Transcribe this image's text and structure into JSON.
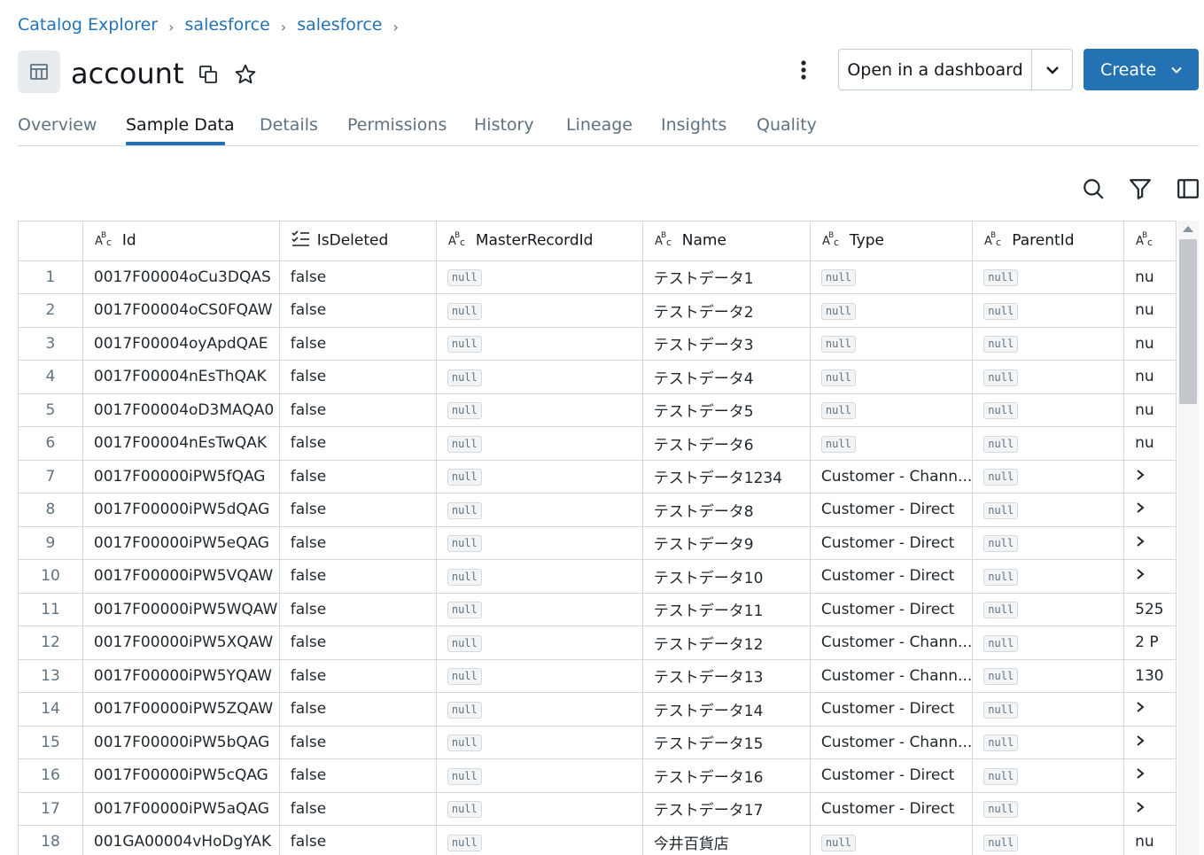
{
  "breadcrumb": [
    {
      "label": "Catalog Explorer"
    },
    {
      "label": "salesforce"
    },
    {
      "label": "salesforce"
    }
  ],
  "title": "account",
  "header_actions": {
    "open_dashboard_label": "Open in a dashboard",
    "create_label": "Create"
  },
  "tabs": [
    {
      "label": "Overview",
      "active": false
    },
    {
      "label": "Sample Data",
      "active": true
    },
    {
      "label": "Details",
      "active": false
    },
    {
      "label": "Permissions",
      "active": false
    },
    {
      "label": "History",
      "active": false
    },
    {
      "label": "Lineage",
      "active": false
    },
    {
      "label": "Insights",
      "active": false
    },
    {
      "label": "Quality",
      "active": false
    }
  ],
  "toolbar_icons": [
    "search-icon",
    "filter-icon",
    "sidebar-panel-icon"
  ],
  "accent_color": "#2272b4",
  "table": {
    "columns": [
      {
        "label": "",
        "icon": ""
      },
      {
        "label": "Id",
        "icon": "string-type-icon"
      },
      {
        "label": "IsDeleted",
        "icon": "boolean-type-icon"
      },
      {
        "label": "MasterRecordId",
        "icon": "string-type-icon"
      },
      {
        "label": "Name",
        "icon": "string-type-icon"
      },
      {
        "label": "Type",
        "icon": "string-type-icon"
      },
      {
        "label": "ParentId",
        "icon": "string-type-icon"
      },
      {
        "label": "",
        "icon": "string-type-icon"
      }
    ],
    "null_label": "null",
    "rows": [
      [
        "1",
        "0017F00004oCu3DQAS",
        "false",
        null,
        "テストデータ1",
        null,
        null,
        "nu"
      ],
      [
        "2",
        "0017F00004oCS0FQAW",
        "false",
        null,
        "テストデータ2",
        null,
        null,
        "nu"
      ],
      [
        "3",
        "0017F00004oyApdQAE",
        "false",
        null,
        "テストデータ3",
        null,
        null,
        "nu"
      ],
      [
        "4",
        "0017F00004nEsThQAK",
        "false",
        null,
        "テストデータ4",
        null,
        null,
        "nu"
      ],
      [
        "5",
        "0017F00004oD3MAQA0",
        "false",
        null,
        "テストデータ5",
        null,
        null,
        "nu"
      ],
      [
        "6",
        "0017F00004nEsTwQAK",
        "false",
        null,
        "テストデータ6",
        null,
        null,
        "nu"
      ],
      [
        "7",
        "0017F00000iPW5fQAG",
        "false",
        null,
        "テストデータ1234",
        "Customer - Chann...",
        null,
        ">"
      ],
      [
        "8",
        "0017F00000iPW5dQAG",
        "false",
        null,
        "テストデータ8",
        "Customer - Direct",
        null,
        ">"
      ],
      [
        "9",
        "0017F00000iPW5eQAG",
        "false",
        null,
        "テストデータ9",
        "Customer - Direct",
        null,
        ">"
      ],
      [
        "10",
        "0017F00000iPW5VQAW",
        "false",
        null,
        "テストデータ10",
        "Customer - Direct",
        null,
        ">"
      ],
      [
        "11",
        "0017F00000iPW5WQAW",
        "false",
        null,
        "テストデータ11",
        "Customer - Direct",
        null,
        "525"
      ],
      [
        "12",
        "0017F00000iPW5XQAW",
        "false",
        null,
        "テストデータ12",
        "Customer - Chann...",
        null,
        "2 P"
      ],
      [
        "13",
        "0017F00000iPW5YQAW",
        "false",
        null,
        "テストデータ13",
        "Customer - Chann...",
        null,
        "130"
      ],
      [
        "14",
        "0017F00000iPW5ZQAW",
        "false",
        null,
        "テストデータ14",
        "Customer - Direct",
        null,
        ">"
      ],
      [
        "15",
        "0017F00000iPW5bQAG",
        "false",
        null,
        "テストデータ15",
        "Customer - Chann...",
        null,
        ">"
      ],
      [
        "16",
        "0017F00000iPW5cQAG",
        "false",
        null,
        "テストデータ16",
        "Customer - Direct",
        null,
        ">"
      ],
      [
        "17",
        "0017F00000iPW5aQAG",
        "false",
        null,
        "テストデータ17",
        "Customer - Direct",
        null,
        ">"
      ],
      [
        "18",
        "001GA00004vHoDgYAK",
        "false",
        null,
        "今井百貨店",
        null,
        null,
        "nu"
      ]
    ]
  }
}
